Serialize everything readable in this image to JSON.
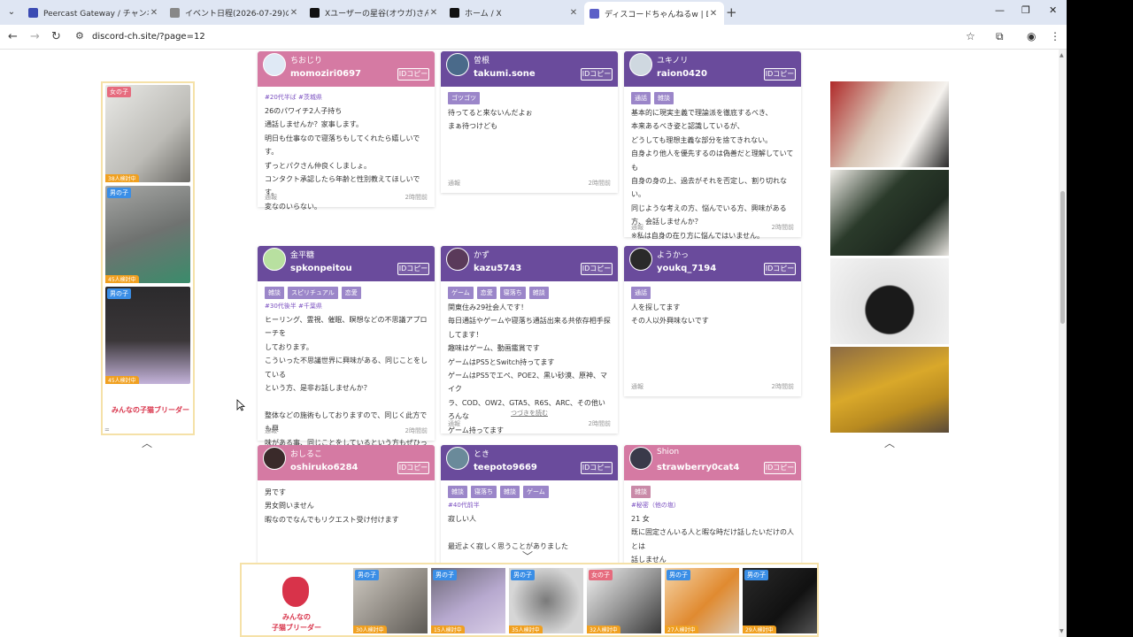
{
  "browser": {
    "tabs": [
      {
        "title": "Peercast Gateway / チャンネル / ...",
        "favicon_color": "#3b4bb3"
      },
      {
        "title": "イベント日程(2026-07-29)の編集",
        "favicon_color": "#888888"
      },
      {
        "title": "Xユーザーの星谷(オウガ)さん: /ピア",
        "favicon_color": "#111111"
      },
      {
        "title": "ホーム / X",
        "favicon_color": "#111111"
      },
      {
        "title": "ディスコードちゃんねるw | Discord",
        "favicon_color": "#5b5fc7",
        "active": true
      }
    ],
    "url": "discord-ch.site/?page=12"
  },
  "left_ad": {
    "cats": [
      {
        "sex": "女の子",
        "sex_class": "female",
        "views": "38人検討中"
      },
      {
        "sex": "男の子",
        "sex_class": "male",
        "views": "45人検討中"
      },
      {
        "sex": "男の子",
        "sex_class": "male",
        "views": "45人検討中"
      }
    ],
    "brand": "みんなの子猫ブリーダー",
    "menu": "="
  },
  "id_button_label": "IDコピー",
  "cards": [
    {
      "theme": "pink",
      "nick": "ちおじり",
      "uid": "momoziri0697",
      "tags": [],
      "hash": "#20代半ば #茨城県",
      "text": [
        "26のパワイチ2人子持ち",
        "通話しませんか？家事します。",
        "明日も仕事なので寝落ちもしてくれたら嬉しいです。",
        "ずっとパクさん仲良くしましょ。",
        "コンタクト承認したら年齢と性別教えてほしいです。",
        "変なのいらない。"
      ],
      "report": "通報",
      "time": "2時間前",
      "more": ""
    },
    {
      "theme": "purple",
      "nick": "曽根",
      "uid": "takumi.sone",
      "tags": [
        "ゴツゴツ"
      ],
      "hash": "",
      "text": [
        "待ってると来ないんだよぉ",
        "まぁ待つけども"
      ],
      "report": "通報",
      "time": "2時間前",
      "more": ""
    },
    {
      "theme": "purple",
      "nick": "ユキノリ",
      "uid": "raion0420",
      "tags": [
        "通話",
        "雑談"
      ],
      "hash": "",
      "text": [
        "基本的に現実主義で理論派を徹底するべき、",
        "本来あるべき姿と認識しているが、",
        "どうしても理想主義な部分を捨てきれない。",
        "自身より他人を優先するのは偽善だと理解していても",
        "自身の身の上、過去がそれを否定し、割り切れない。",
        "同じような考えの方、悩んでいる方、興味がある方、会話しませんか？",
        "※私は自身の在り方に悩んではいません。"
      ],
      "report": "通報",
      "time": "2時間前",
      "more": ""
    },
    {
      "theme": "purple",
      "nick": "金平糖",
      "uid": "spkonpeitou",
      "tags": [
        "雑談",
        "スピリチュアル",
        "恋愛"
      ],
      "hash": "#30代後半 #千葉県",
      "text": [
        "ヒーリング、霊視、催眠、瞑想などの不思議アプローチを",
        "しております。",
        "こういった不思議世界に興味がある、同じことをしている",
        "という方、是非お話しませんか？",
        "",
        "整体などの施術もしておりますので、同じく此方でも興",
        "味がある事、同じことをしているという方もぜひっ"
      ],
      "report": "通報",
      "time": "2時間前",
      "more": ""
    },
    {
      "theme": "purple",
      "nick": "かず",
      "uid": "kazu5743",
      "tags": [
        "ゲーム",
        "恋愛",
        "寝落ち",
        "雑談"
      ],
      "hash": "",
      "text": [
        "関東住み29社会人です！",
        "毎日通話やゲームや寝落ち通話出来る共依存相手探",
        "してます！",
        "趣味はゲーム、動画鑑賞です",
        "ゲームはPS5とSwitch持ってます",
        "ゲームはPS5でエペ、POE2、黒い砂漠、原神、マイク",
        "ラ、COD、OW2、GTA5、R6S、ARC、その他いろんな",
        "ゲーム持ってます"
      ],
      "report": "通報",
      "time": "2時間前",
      "more": "つづきを読む"
    },
    {
      "theme": "purple",
      "nick": "ようかっ",
      "uid": "youkq_7194",
      "tags": [
        "通話"
      ],
      "hash": "",
      "text": [
        "人を探してます",
        "その人以外興味ないです"
      ],
      "report": "通報",
      "time": "2時間前",
      "more": ""
    },
    {
      "theme": "pink",
      "nick": "おしるこ",
      "uid": "oshiruko6284",
      "tags": [],
      "hash": "",
      "text": [
        "男です",
        "男女問いません",
        "暇なのでなんでもリクエスト受け付けます"
      ],
      "report": "",
      "time": "",
      "more": ""
    },
    {
      "theme": "purple",
      "nick": "とき",
      "uid": "teepoto9669",
      "tags": [
        "雑談",
        "寝落ち",
        "雑談",
        "ゲーム"
      ],
      "hash": "#40代前半",
      "text": [
        "寂しい人",
        "",
        "最近よく寂しく思うことがありました"
      ],
      "report": "",
      "time": "",
      "more": ""
    },
    {
      "theme": "pink",
      "nick": "Shion",
      "uid": "strawberry0cat4",
      "tags": [
        "雑談"
      ],
      "hash": "#秘密（他の塩）",
      "text": [
        "21 女",
        "既に固定さんいる人と暇な時だけ話したいだけの人とは",
        "話しません"
      ],
      "report": "",
      "time": "",
      "more": ""
    }
  ],
  "bottom_ad": {
    "brand_line1": "みんなの",
    "brand_line2": "子猫ブリーダー",
    "cats": [
      {
        "sex": "男の子",
        "sex_class": "male",
        "views": "30人検討中"
      },
      {
        "sex": "男の子",
        "sex_class": "male",
        "views": "15人検討中"
      },
      {
        "sex": "男の子",
        "sex_class": "male",
        "views": "35人検討中"
      },
      {
        "sex": "女の子",
        "sex_class": "female",
        "views": "32人検討中"
      },
      {
        "sex": "男の子",
        "sex_class": "male",
        "views": "27人検討中"
      },
      {
        "sex": "男の子",
        "sex_class": "male",
        "views": "29人検討中"
      }
    ]
  },
  "colors": {
    "pink_header": "#d57aa3",
    "purple_header": "#6a4b9c",
    "tag_purple": "#9b86c9"
  }
}
